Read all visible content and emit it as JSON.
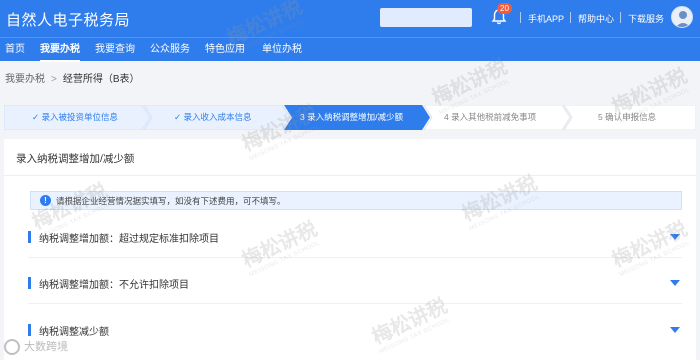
{
  "header": {
    "app_title": "自然人电子税务局",
    "notification_count": "20",
    "links": [
      "手机APP",
      "帮助中心",
      "下载服务"
    ],
    "bg_color": "#2f7ded"
  },
  "nav": {
    "items": [
      "首页",
      "我要办税",
      "我要查询",
      "公众服务",
      "特色应用",
      "单位办税"
    ],
    "active_index": 1
  },
  "breadcrumb": {
    "root": "我要办税",
    "current": "经营所得（B表）"
  },
  "steps": [
    {
      "label": "✓ 录入被投资单位信息",
      "state": "done"
    },
    {
      "label": "✓ 录入收入成本信息",
      "state": "done"
    },
    {
      "label": "3  录入纳税调整增加/减少额",
      "state": "active"
    },
    {
      "label": "4  录入其他税前减免事项",
      "state": "todo"
    },
    {
      "label": "5  确认申报信息",
      "state": "todo"
    }
  ],
  "card": {
    "title": "录入纳税调整增加/减少额",
    "notice": "请根据企业经营情况据实填写，如没有下述费用，可不填写。",
    "sections": [
      "纳税调整增加额：超过规定标准扣除项目",
      "纳税调整增加额：不允许扣除项目",
      "纳税调整减少额"
    ]
  },
  "watermark": {
    "text": "梅松讲税",
    "sub": "MEISONG TAX SCHOOL"
  },
  "corner_logo": "大数跨境"
}
